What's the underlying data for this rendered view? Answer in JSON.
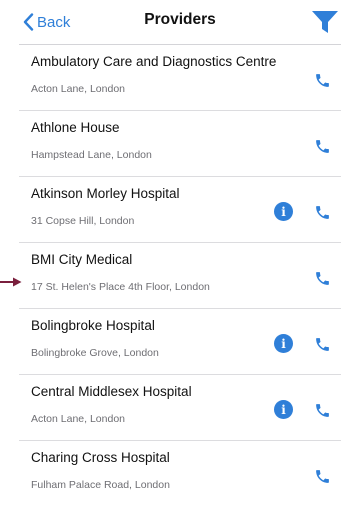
{
  "nav": {
    "back_label": "Back",
    "title": "Providers",
    "back_icon": "chevron-left-icon",
    "filter_icon": "filter-funnel-icon"
  },
  "colors": {
    "accent": "#2f7fd8",
    "pointer_arrow": "#7a1f3d",
    "subtitle": "#6e6e73",
    "separator": "#dcdcdf"
  },
  "providers": [
    {
      "name": "Ambulatory Care and Diagnostics Centre",
      "address": "Acton Lane, London",
      "has_info": false
    },
    {
      "name": "Athlone House",
      "address": "Hampstead Lane, London",
      "has_info": false
    },
    {
      "name": "Atkinson Morley Hospital",
      "address": "31 Copse Hill, London",
      "has_info": true
    },
    {
      "name": "BMI City Medical",
      "address": "17 St. Helen's Place 4th Floor, London",
      "has_info": false
    },
    {
      "name": "Bolingbroke Hospital",
      "address": "Bolingbroke Grove, London",
      "has_info": true
    },
    {
      "name": "Central Middlesex Hospital",
      "address": "Acton Lane, London",
      "has_info": true
    },
    {
      "name": "Charing Cross Hospital",
      "address": "Fulham Palace Road, London",
      "has_info": false
    }
  ],
  "row_icons": {
    "phone": "phone-icon",
    "info": "info-icon",
    "info_glyph": "i"
  },
  "annotation": {
    "pointer_icon": "arrow-right-icon"
  }
}
